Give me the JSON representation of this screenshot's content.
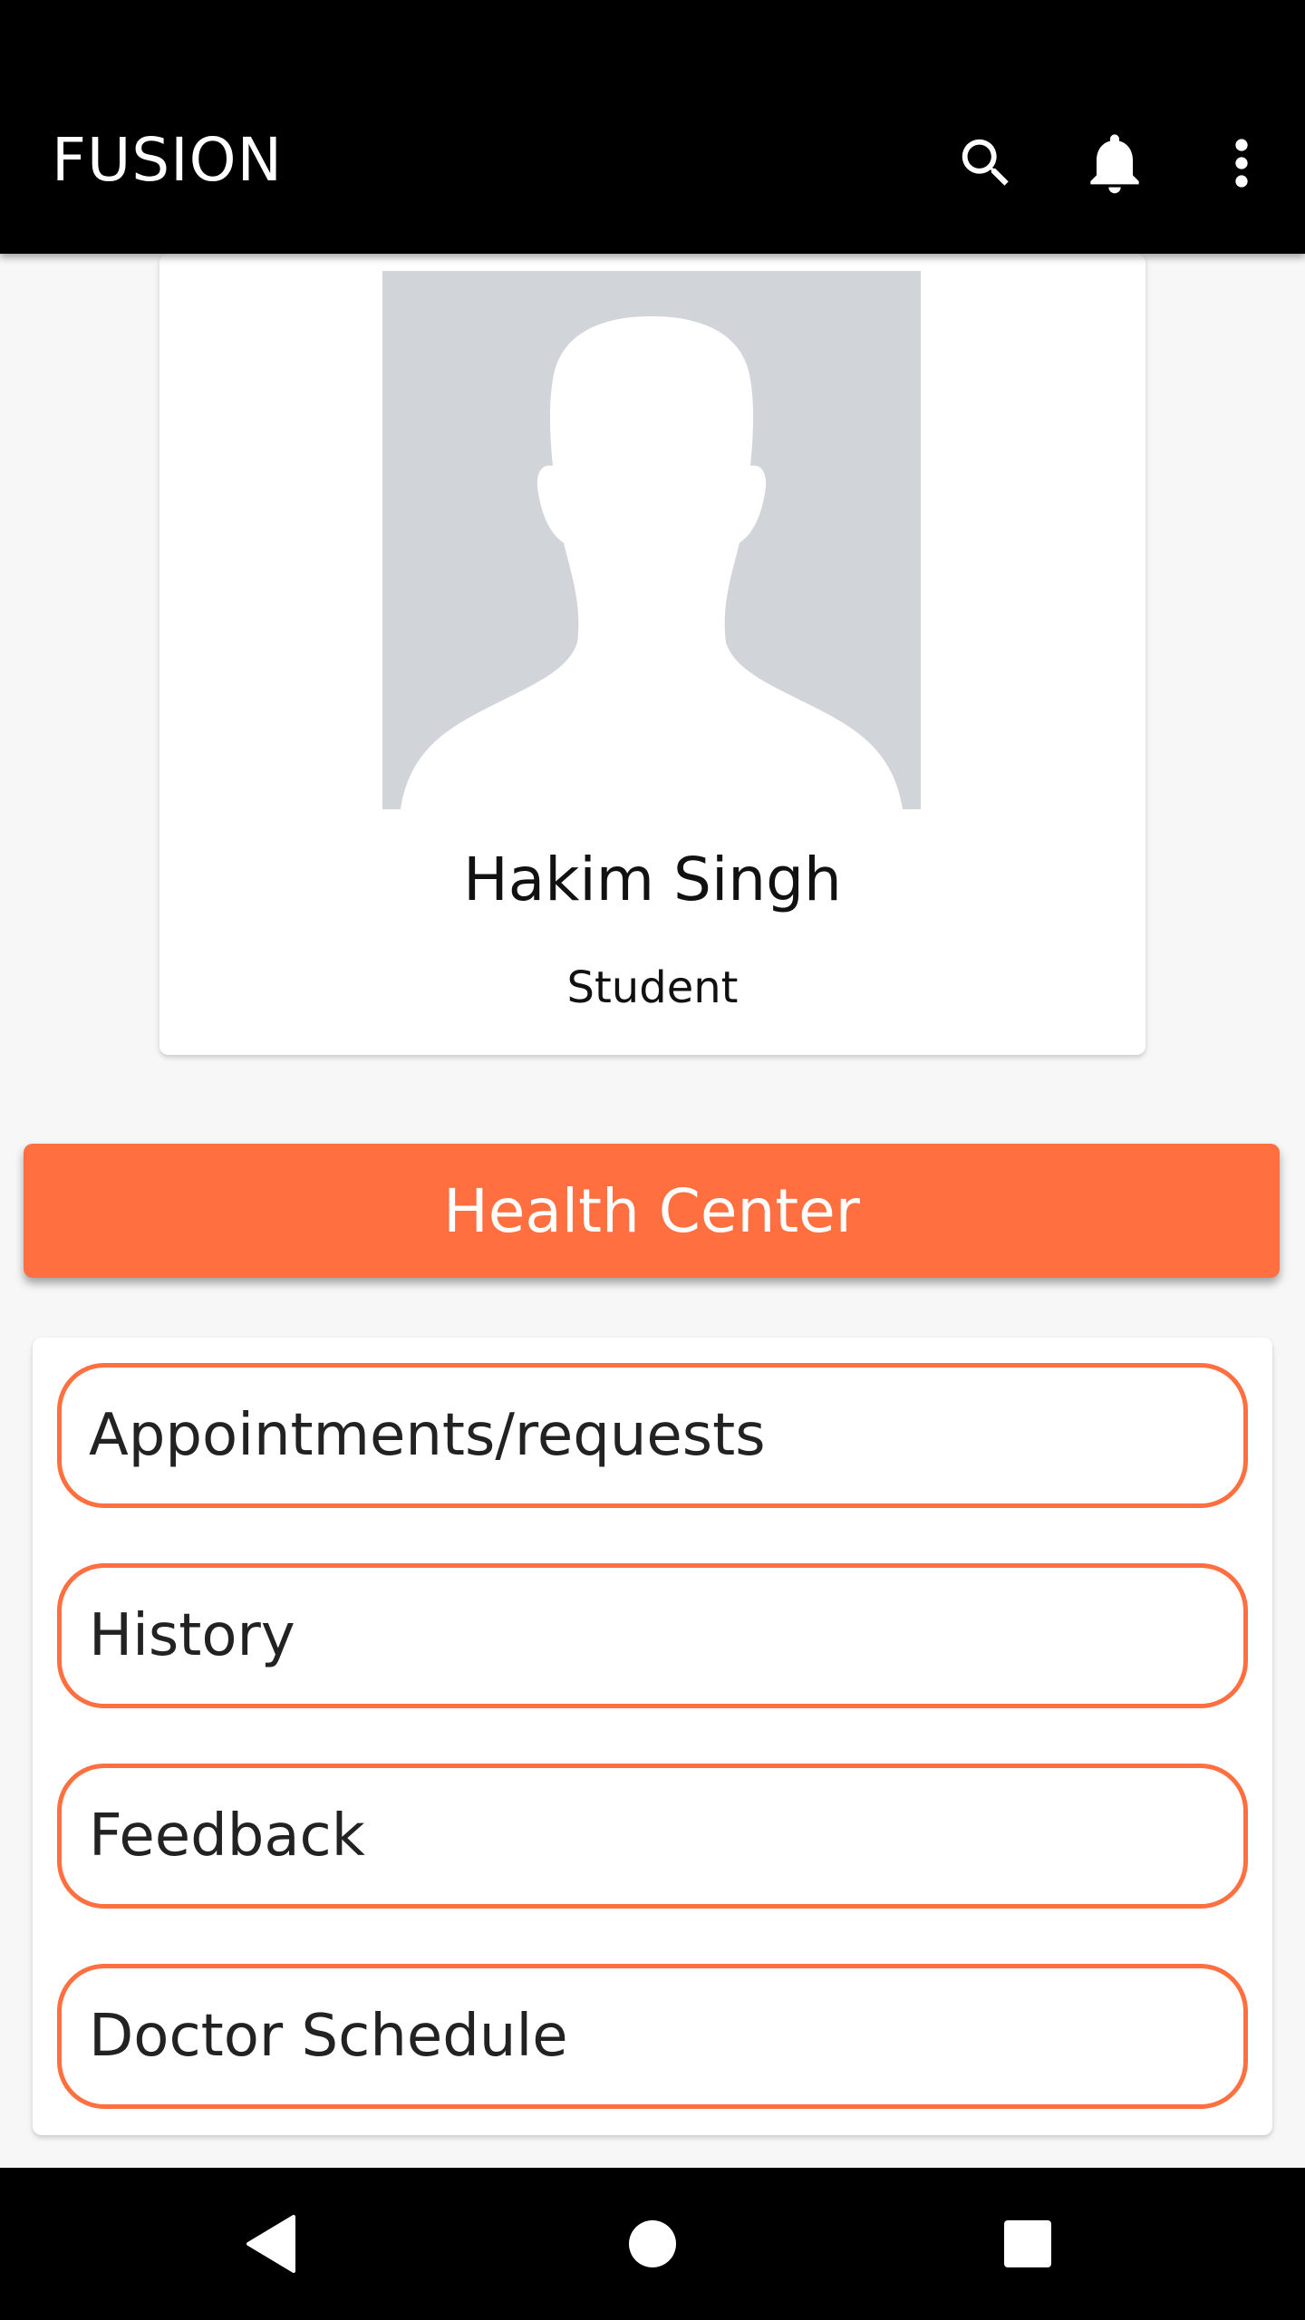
{
  "appbar": {
    "title": "FUSION",
    "icons": [
      "search-icon",
      "bell-icon",
      "more-vert-icon"
    ]
  },
  "profile": {
    "name": "Hakim Singh",
    "role": "Student",
    "avatar_icon": "person-silhouette"
  },
  "section": {
    "title": "Health Center"
  },
  "menu": {
    "items": [
      {
        "label": "Appointments/requests"
      },
      {
        "label": "History"
      },
      {
        "label": "Feedback"
      },
      {
        "label": "Doctor Schedule"
      }
    ]
  },
  "navbar": {
    "icons": [
      "back-icon",
      "home-icon",
      "recents-icon"
    ]
  },
  "colors": {
    "accent": "#ff6f40",
    "appbar": "#000000",
    "background": "#f7f7f7",
    "avatar_bg": "#d1d5da"
  }
}
